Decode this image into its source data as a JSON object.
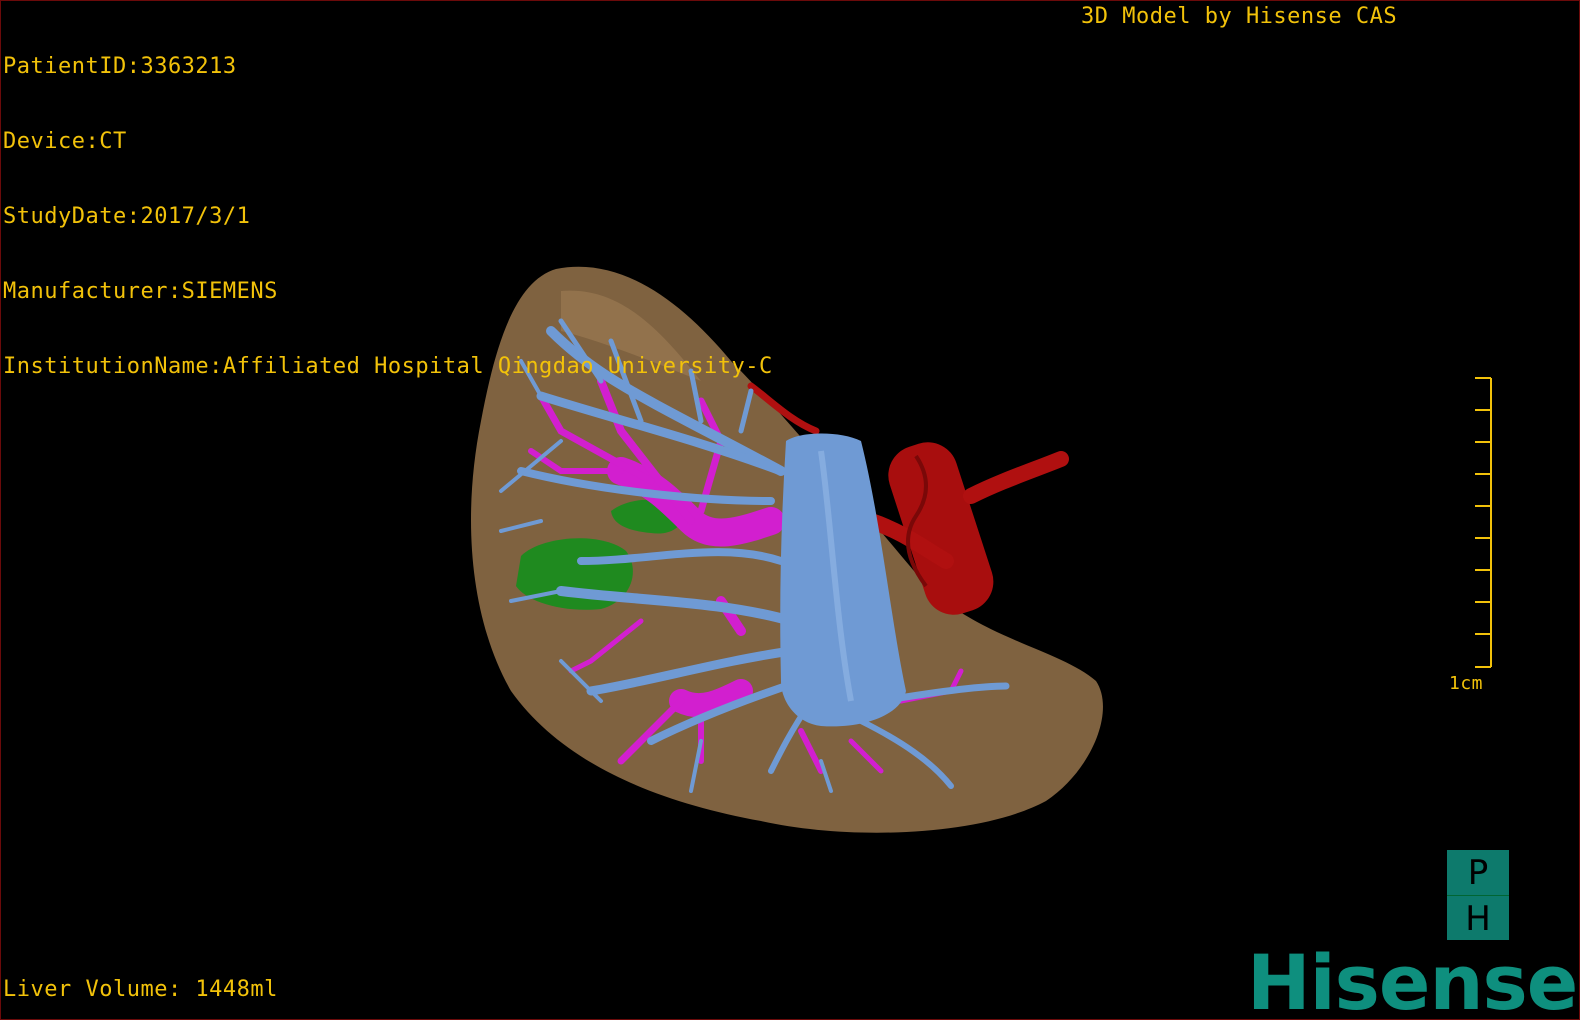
{
  "info": {
    "patient_id": "PatientID:3363213",
    "device": "Device:CT",
    "study_date": "StudyDate:2017/3/1",
    "manufacturer": "Manufacturer:SIEMENS",
    "institution": "InstitutionName:Affiliated Hospital Qingdao University-C"
  },
  "brand_line": "3D Model by Hisense CAS",
  "volume": "Liver Volume: 1448ml",
  "scale_bar": {
    "label": "1cm"
  },
  "orientation": {
    "top": "P",
    "bottom": "H"
  },
  "logo": "Hisense",
  "colors": {
    "overlay_text": "#f2c20a",
    "liver": "#8a6a45",
    "hepatic_vein": "#6f9ad4",
    "portal_vein": "#d21fcf",
    "lesion": "#1f8a1f",
    "artery": "#b01010",
    "logo": "#0e8f7e"
  }
}
